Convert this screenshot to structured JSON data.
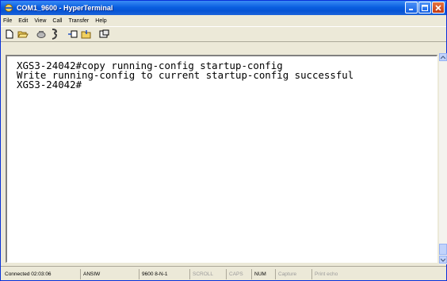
{
  "window": {
    "title": "COM1_9600 - HyperTerminal",
    "accent_color": "#0a5fe0",
    "close_color": "#c23b14"
  },
  "menu": {
    "items": [
      "File",
      "Edit",
      "View",
      "Call",
      "Transfer",
      "Help"
    ]
  },
  "toolbar": {
    "icons": [
      "new-icon",
      "open-icon",
      "disconnect-icon",
      "properties-phone-icon",
      "send-icon",
      "receive-icon",
      "settings-icon"
    ]
  },
  "terminal": {
    "lines": [
      "XGS3-24042#copy running-config startup-config",
      "Write running-config to current startup-config successful",
      "XGS3-24042#"
    ]
  },
  "status": {
    "connected": "Connected 02:03:06",
    "emulation": "ANSIW",
    "port_settings": "9600 8-N-1",
    "scroll": "SCROLL",
    "caps": "CAPS",
    "num": "NUM",
    "capture": "Capture",
    "print_echo": "Print echo"
  }
}
